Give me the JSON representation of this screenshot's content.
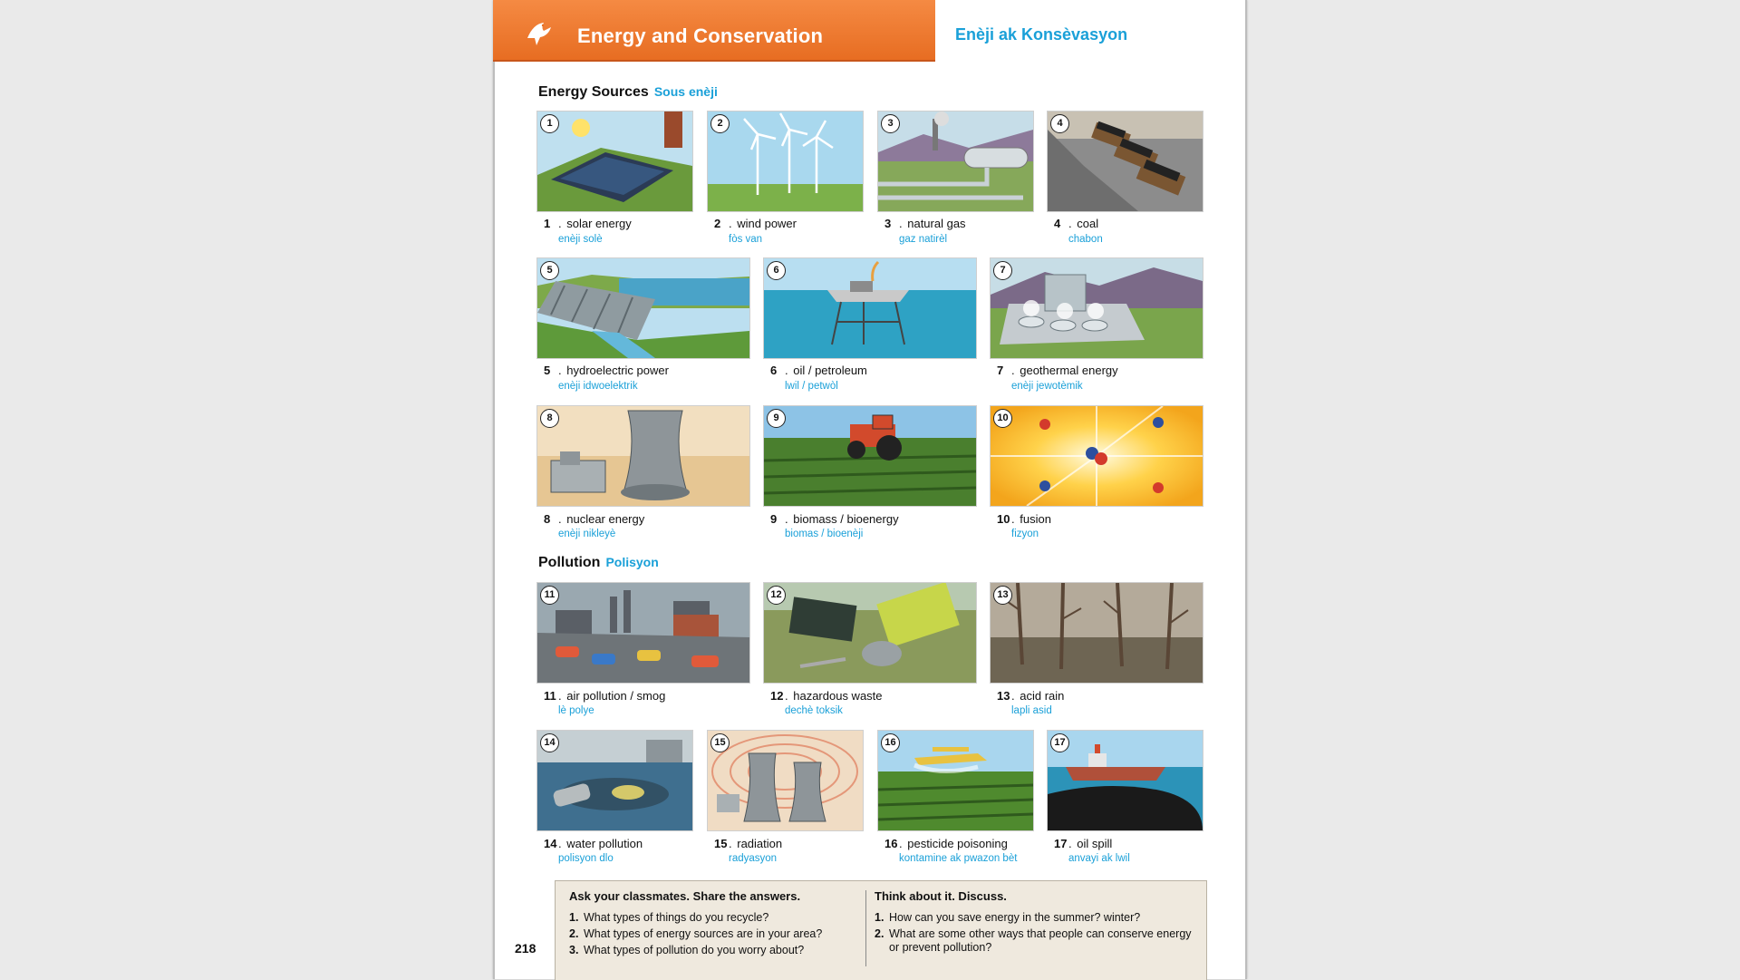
{
  "header": {
    "title": "Energy and Conservation",
    "title_translation": "Enèji ak Konsèvasyon"
  },
  "sections": {
    "energy": {
      "label": "Energy Sources",
      "translation": "Sous enèji"
    },
    "pollution": {
      "label": "Pollution",
      "translation": "Polisyon"
    }
  },
  "items": [
    {
      "num": "1",
      "label": "solar energy",
      "translation": "enèji solè",
      "icon": "solar-panel-icon"
    },
    {
      "num": "2",
      "label": "wind power",
      "translation": "fòs van",
      "icon": "wind-turbine-icon"
    },
    {
      "num": "3",
      "label": "natural gas",
      "translation": "gaz natirèl",
      "icon": "gas-pipeline-icon"
    },
    {
      "num": "4",
      "label": "coal",
      "translation": "chabon",
      "icon": "coal-mine-icon"
    },
    {
      "num": "5",
      "label": "hydroelectric power",
      "translation": "enèji idwoelektrik",
      "icon": "dam-icon"
    },
    {
      "num": "6",
      "label": "oil / petroleum",
      "translation": "lwil / petwòl",
      "icon": "oil-rig-icon"
    },
    {
      "num": "7",
      "label": "geothermal energy",
      "translation": "enèji jewotèmik",
      "icon": "geothermal-plant-icon"
    },
    {
      "num": "8",
      "label": "nuclear energy",
      "translation": "enèji nikleyè",
      "icon": "cooling-tower-icon"
    },
    {
      "num": "9",
      "label": "biomass / bioenergy",
      "translation": "biomas / bioenèji",
      "icon": "tractor-icon"
    },
    {
      "num": "10",
      "label": "fusion",
      "translation": "fizyon",
      "icon": "atom-fusion-icon"
    },
    {
      "num": "11",
      "label": "air pollution / smog",
      "translation": "lè polye",
      "icon": "smog-traffic-icon"
    },
    {
      "num": "12",
      "label": "hazardous waste",
      "translation": "dechè toksik",
      "icon": "toxic-barrels-icon"
    },
    {
      "num": "13",
      "label": "acid rain",
      "translation": "lapli asid",
      "icon": "dead-trees-icon"
    },
    {
      "num": "14",
      "label": "water pollution",
      "translation": "polisyon dlo",
      "icon": "polluted-water-icon"
    },
    {
      "num": "15",
      "label": "radiation",
      "translation": "radyasyon",
      "icon": "radiation-icon"
    },
    {
      "num": "16",
      "label": "pesticide poisoning",
      "translation": "kontamine ak pwazon bèt",
      "icon": "crop-duster-icon"
    },
    {
      "num": "17",
      "label": "oil spill",
      "translation": "anvayi ak lwil",
      "icon": "oil-tanker-icon"
    }
  ],
  "discussion": {
    "ask": {
      "heading": "Ask your classmates. Share the answers.",
      "questions": [
        {
          "num": "1.",
          "text": "What types of things do you recycle?"
        },
        {
          "num": "2.",
          "text": "What types of energy sources are in your area?"
        },
        {
          "num": "3.",
          "text": "What types of pollution do you worry about?"
        }
      ]
    },
    "think": {
      "heading": "Think about it. Discuss.",
      "questions": [
        {
          "num": "1.",
          "text": "How can you save energy in the summer? winter?"
        },
        {
          "num": "2.",
          "text": "What are some other ways that people can conserve energy or prevent pollution?"
        }
      ]
    }
  },
  "page_number": "218",
  "colors": {
    "banner": "#ef7a2f",
    "translation": "#1aa0d8",
    "discussion_bg": "#efe9de"
  }
}
